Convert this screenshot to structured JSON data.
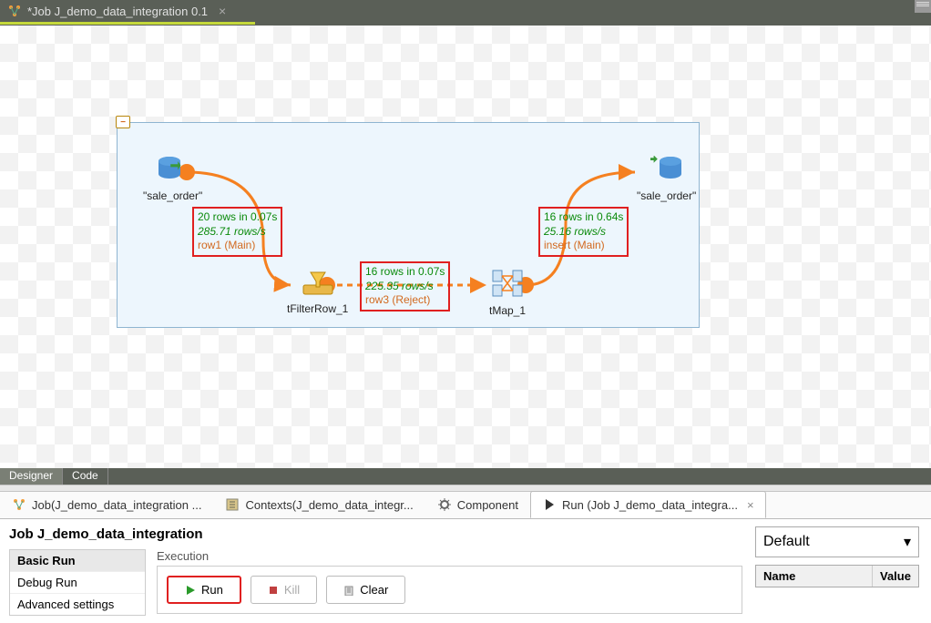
{
  "tab": {
    "title": "*Job J_demo_data_integration 0.1"
  },
  "nodes": {
    "input": {
      "label": "\"sale_order\""
    },
    "filter": {
      "label": "tFilterRow_1"
    },
    "tmap": {
      "label": "tMap_1"
    },
    "output": {
      "label": "\"sale_order\""
    }
  },
  "metrics": {
    "m1": {
      "a": "20 rows in 0.07s",
      "b": "285.71 rows/s",
      "c": "row1 (Main)"
    },
    "m2": {
      "a": "16 rows in 0.07s",
      "b": "225.35 rows/s",
      "c": "row3 (Reject)"
    },
    "m3": {
      "a": "16 rows in 0.64s",
      "b": "25.16 rows/s",
      "c": "insert (Main)"
    }
  },
  "designer_tabs": {
    "designer": "Designer",
    "code": "Code"
  },
  "bottom_tabs": {
    "job": "Job(J_demo_data_integration ...",
    "contexts": "Contexts(J_demo_data_integr...",
    "component": "Component",
    "run": "Run (Job J_demo_data_integra..."
  },
  "run_panel": {
    "title": "Job J_demo_data_integration",
    "sections": {
      "basic": "Basic Run",
      "debug": "Debug Run",
      "advanced": "Advanced settings"
    },
    "execution_label": "Execution",
    "buttons": {
      "run": "Run",
      "kill": "Kill",
      "clear": "Clear"
    },
    "context_select": "Default",
    "props": {
      "name": "Name",
      "value": "Value"
    }
  }
}
